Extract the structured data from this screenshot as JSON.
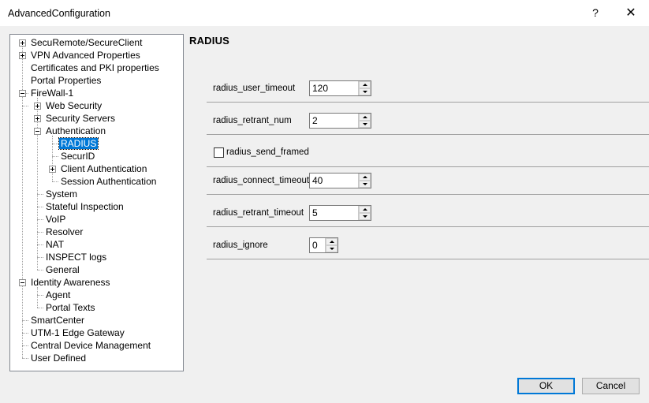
{
  "window": {
    "title": "AdvancedConfiguration",
    "help_label": "?",
    "close_label": "✕"
  },
  "tree": {
    "items": [
      {
        "label": "SecuRemote/SecureClient"
      },
      {
        "label": "VPN Advanced Properties"
      },
      {
        "label": "Certificates and PKI properties"
      },
      {
        "label": "Portal Properties"
      },
      {
        "label": "FireWall-1"
      },
      {
        "label": "Web Security"
      },
      {
        "label": "Security Servers"
      },
      {
        "label": "Authentication"
      },
      {
        "label": "RADIUS"
      },
      {
        "label": "SecurID"
      },
      {
        "label": "Client Authentication"
      },
      {
        "label": "Session Authentication"
      },
      {
        "label": "System"
      },
      {
        "label": "Stateful Inspection"
      },
      {
        "label": "VoIP"
      },
      {
        "label": "Resolver"
      },
      {
        "label": "NAT"
      },
      {
        "label": "INSPECT logs"
      },
      {
        "label": "General"
      },
      {
        "label": "Identity Awareness"
      },
      {
        "label": "Agent"
      },
      {
        "label": "Portal Texts"
      },
      {
        "label": "SmartCenter"
      },
      {
        "label": "UTM-1 Edge Gateway"
      },
      {
        "label": "Central Device Management"
      },
      {
        "label": "User Defined"
      }
    ]
  },
  "section": {
    "title": "RADIUS"
  },
  "fields": {
    "user_timeout": {
      "label": "radius_user_timeout",
      "value": "120"
    },
    "retrant_num": {
      "label": "radius_retrant_num",
      "value": "2"
    },
    "send_framed": {
      "label": "radius_send_framed",
      "checked": false
    },
    "connect_timeout": {
      "label": "radius_connect_timeout",
      "value": "40"
    },
    "retrant_timeout": {
      "label": "radius_retrant_timeout",
      "value": "5"
    },
    "ignore": {
      "label": "radius_ignore",
      "value": "0"
    }
  },
  "buttons": {
    "ok": "OK",
    "cancel": "Cancel"
  }
}
